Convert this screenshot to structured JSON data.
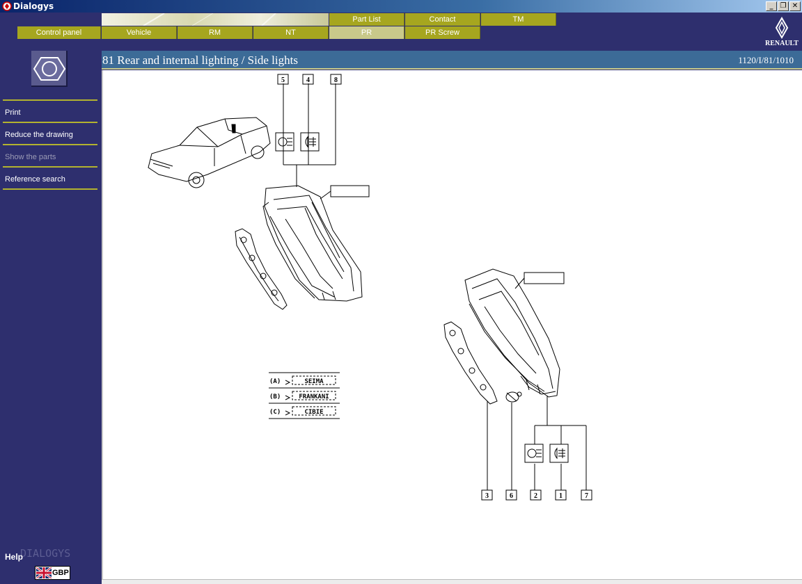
{
  "window": {
    "title": "Dialogys"
  },
  "nav": {
    "top_row": [
      {
        "label": "Part List"
      },
      {
        "label": "Contact"
      },
      {
        "label": "TM"
      }
    ],
    "bottom_row": [
      {
        "label": "Control panel"
      },
      {
        "label": "Vehicle"
      },
      {
        "label": "RM"
      },
      {
        "label": "NT"
      },
      {
        "label": "PR",
        "active": true
      },
      {
        "label": "PR Screw"
      }
    ]
  },
  "brand": {
    "logo_text": "RENAULT"
  },
  "sidebar": {
    "items": [
      {
        "label": "Print",
        "enabled": true
      },
      {
        "label": "Reduce the drawing",
        "enabled": true
      },
      {
        "label": "Show the parts",
        "enabled": false
      },
      {
        "label": "Reference search",
        "enabled": true
      }
    ],
    "help_label": "Help",
    "watermark": "DIALOGYS",
    "currency": "GBP"
  },
  "page": {
    "title": "81 Rear and internal lighting / Side lights",
    "reference": "1120/I/81/1010"
  },
  "drawing": {
    "callouts_top": [
      "5",
      "4",
      "8"
    ],
    "callouts_bottom": [
      "3",
      "6",
      "2",
      "1",
      "7"
    ],
    "legend": [
      {
        "key": "(A)",
        "maker": "SEIMA"
      },
      {
        "key": "(B)",
        "maker": "FRANKANI"
      },
      {
        "key": "(C)",
        "maker": "CIBIE"
      }
    ]
  },
  "colors": {
    "header_bg": "#2e2f6e",
    "tab_olive": "#a6a61f",
    "tab_active": "#c9c98a",
    "title_bar": "#3c6b97"
  }
}
